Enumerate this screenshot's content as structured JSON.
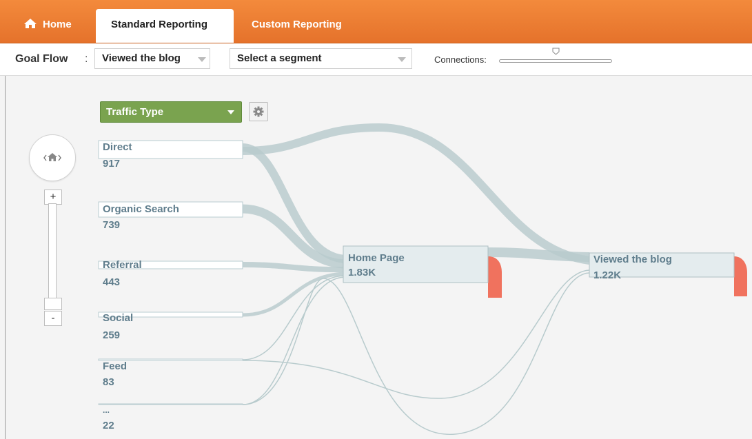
{
  "nav": {
    "home": "Home",
    "standard_reporting": "Standard Reporting",
    "custom_reporting": "Custom Reporting"
  },
  "toolbar": {
    "goal_flow_label": "Goal Flow",
    "goal_flow_colon": ":",
    "goal_select": "Viewed the blog",
    "segment_select": "Select a segment",
    "connections_label": "Connections:"
  },
  "flow": {
    "dimension_select": "Traffic Type",
    "sources": [
      {
        "label": "Direct",
        "value": "917"
      },
      {
        "label": "Organic Search",
        "value": "739"
      },
      {
        "label": "Referral",
        "value": "443"
      },
      {
        "label": "Social",
        "value": "259"
      },
      {
        "label": "Feed",
        "value": "83"
      },
      {
        "label": "...",
        "value": "22"
      }
    ],
    "steps": [
      {
        "label": "Home Page",
        "value": "1.83K"
      },
      {
        "label": "Viewed the blog",
        "value": "1.22K"
      }
    ],
    "zoom_in": "+",
    "zoom_out": "-"
  },
  "colors": {
    "brand_orange": "#e8752d",
    "flow_band": "#b8cbcd",
    "dropoff": "#ef6a55",
    "dimension_green": "#7aa34f",
    "node_text": "#5f7d8c"
  }
}
